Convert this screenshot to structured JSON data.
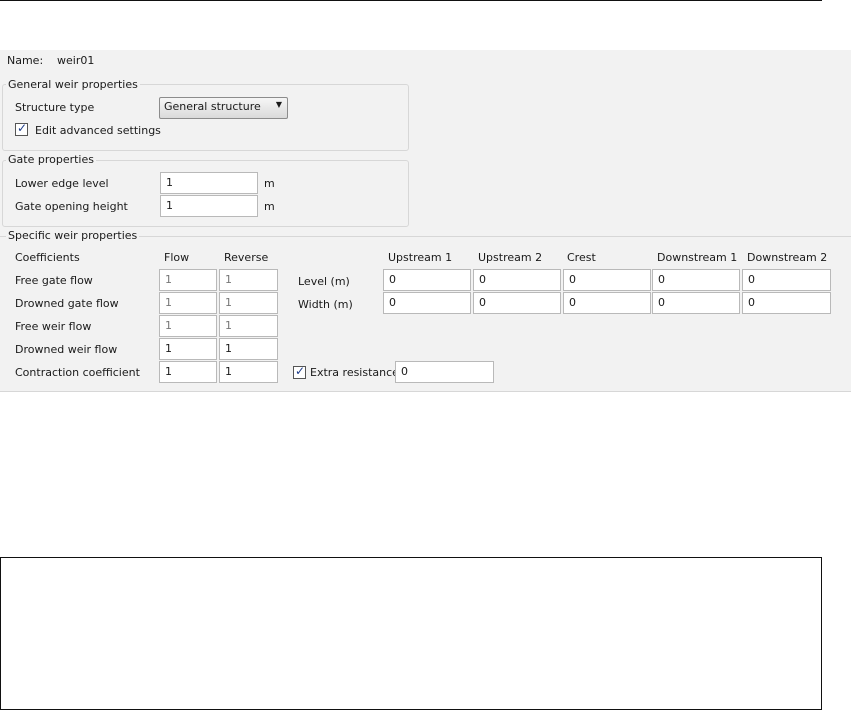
{
  "name_label": "Name:",
  "name_value": "weir01",
  "general": {
    "title": "General weir properties",
    "structure_type_label": "Structure type",
    "structure_type_value": "General structure",
    "advanced_label": "Edit advanced settings",
    "advanced_checked": true
  },
  "gate": {
    "title": "Gate properties",
    "lower_edge_label": "Lower edge level",
    "lower_edge_value": "1",
    "lower_edge_unit": "m",
    "opening_label": "Gate opening height",
    "opening_value": "1",
    "opening_unit": "m"
  },
  "specific": {
    "title": "Specific weir properties",
    "coef_header": "Coefficients",
    "flow_header": "Flow",
    "reverse_header": "Reverse",
    "rows": [
      {
        "label": "Free gate flow",
        "flow": "1",
        "reverse": "1"
      },
      {
        "label": "Drowned gate flow",
        "flow": "1",
        "reverse": "1"
      },
      {
        "label": "Free weir flow",
        "flow": "1",
        "reverse": "1"
      },
      {
        "label": "Drowned weir flow",
        "flow": "1",
        "reverse": "1"
      },
      {
        "label": "Contraction coefficient",
        "flow": "1",
        "reverse": "1"
      }
    ],
    "geo_headers": [
      "Upstream 1",
      "Upstream 2",
      "Crest",
      "Downstream 1",
      "Downstream 2"
    ],
    "level_label": "Level (m)",
    "level_values": [
      "0",
      "0",
      "0",
      "0",
      "0"
    ],
    "width_label": "Width (m)",
    "width_values": [
      "0",
      "0",
      "0",
      "0",
      "0"
    ],
    "extra_resistance_label": "Extra resistance",
    "extra_resistance_checked": true,
    "extra_resistance_value": "0"
  }
}
